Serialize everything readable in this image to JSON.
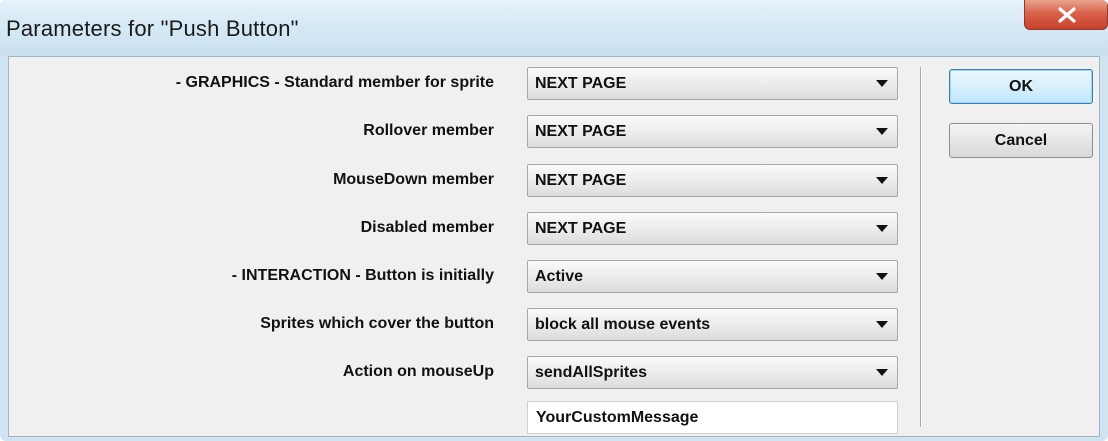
{
  "window": {
    "title": "Parameters for \"Push Button\""
  },
  "fields": [
    {
      "label": "- GRAPHICS - Standard member for sprite",
      "value": "NEXT PAGE"
    },
    {
      "label": "Rollover member",
      "value": "NEXT PAGE"
    },
    {
      "label": "MouseDown member",
      "value": "NEXT PAGE"
    },
    {
      "label": "Disabled member",
      "value": "NEXT PAGE"
    },
    {
      "label": "- INTERACTION - Button is initially",
      "value": "Active"
    },
    {
      "label": "Sprites which cover the button",
      "value": "block all mouse events"
    },
    {
      "label": "Action on mouseUp",
      "value": "sendAllSprites"
    }
  ],
  "custom_message": {
    "value": "YourCustomMessage"
  },
  "buttons": {
    "ok": "OK",
    "cancel": "Cancel"
  },
  "icons": {
    "close": "close-icon",
    "dropdown": "chevron-down-icon"
  },
  "colors": {
    "close_button": "#d9624b",
    "default_button_border": "#3c7fb1",
    "dialog_background": "#f0f0f0"
  }
}
